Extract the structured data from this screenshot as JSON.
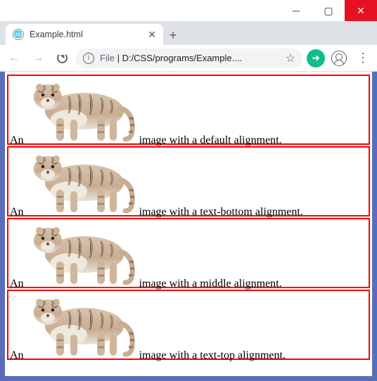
{
  "window": {
    "tab_title": "Example.html",
    "url_scheme": "File",
    "url_path": "D:/CSS/programs/Example....",
    "ext_badge_glyph": "➜"
  },
  "rows": [
    {
      "prefix": "An",
      "suffix": "image with a default alignment.",
      "valign": "baseline"
    },
    {
      "prefix": "An",
      "suffix": "image with a text-bottom alignment.",
      "valign": "text-bottom"
    },
    {
      "prefix": "An",
      "suffix": "image with a middle alignment.",
      "valign": "middle"
    },
    {
      "prefix": "An",
      "suffix": "image with a text-top alignment.",
      "valign": "text-top"
    }
  ]
}
